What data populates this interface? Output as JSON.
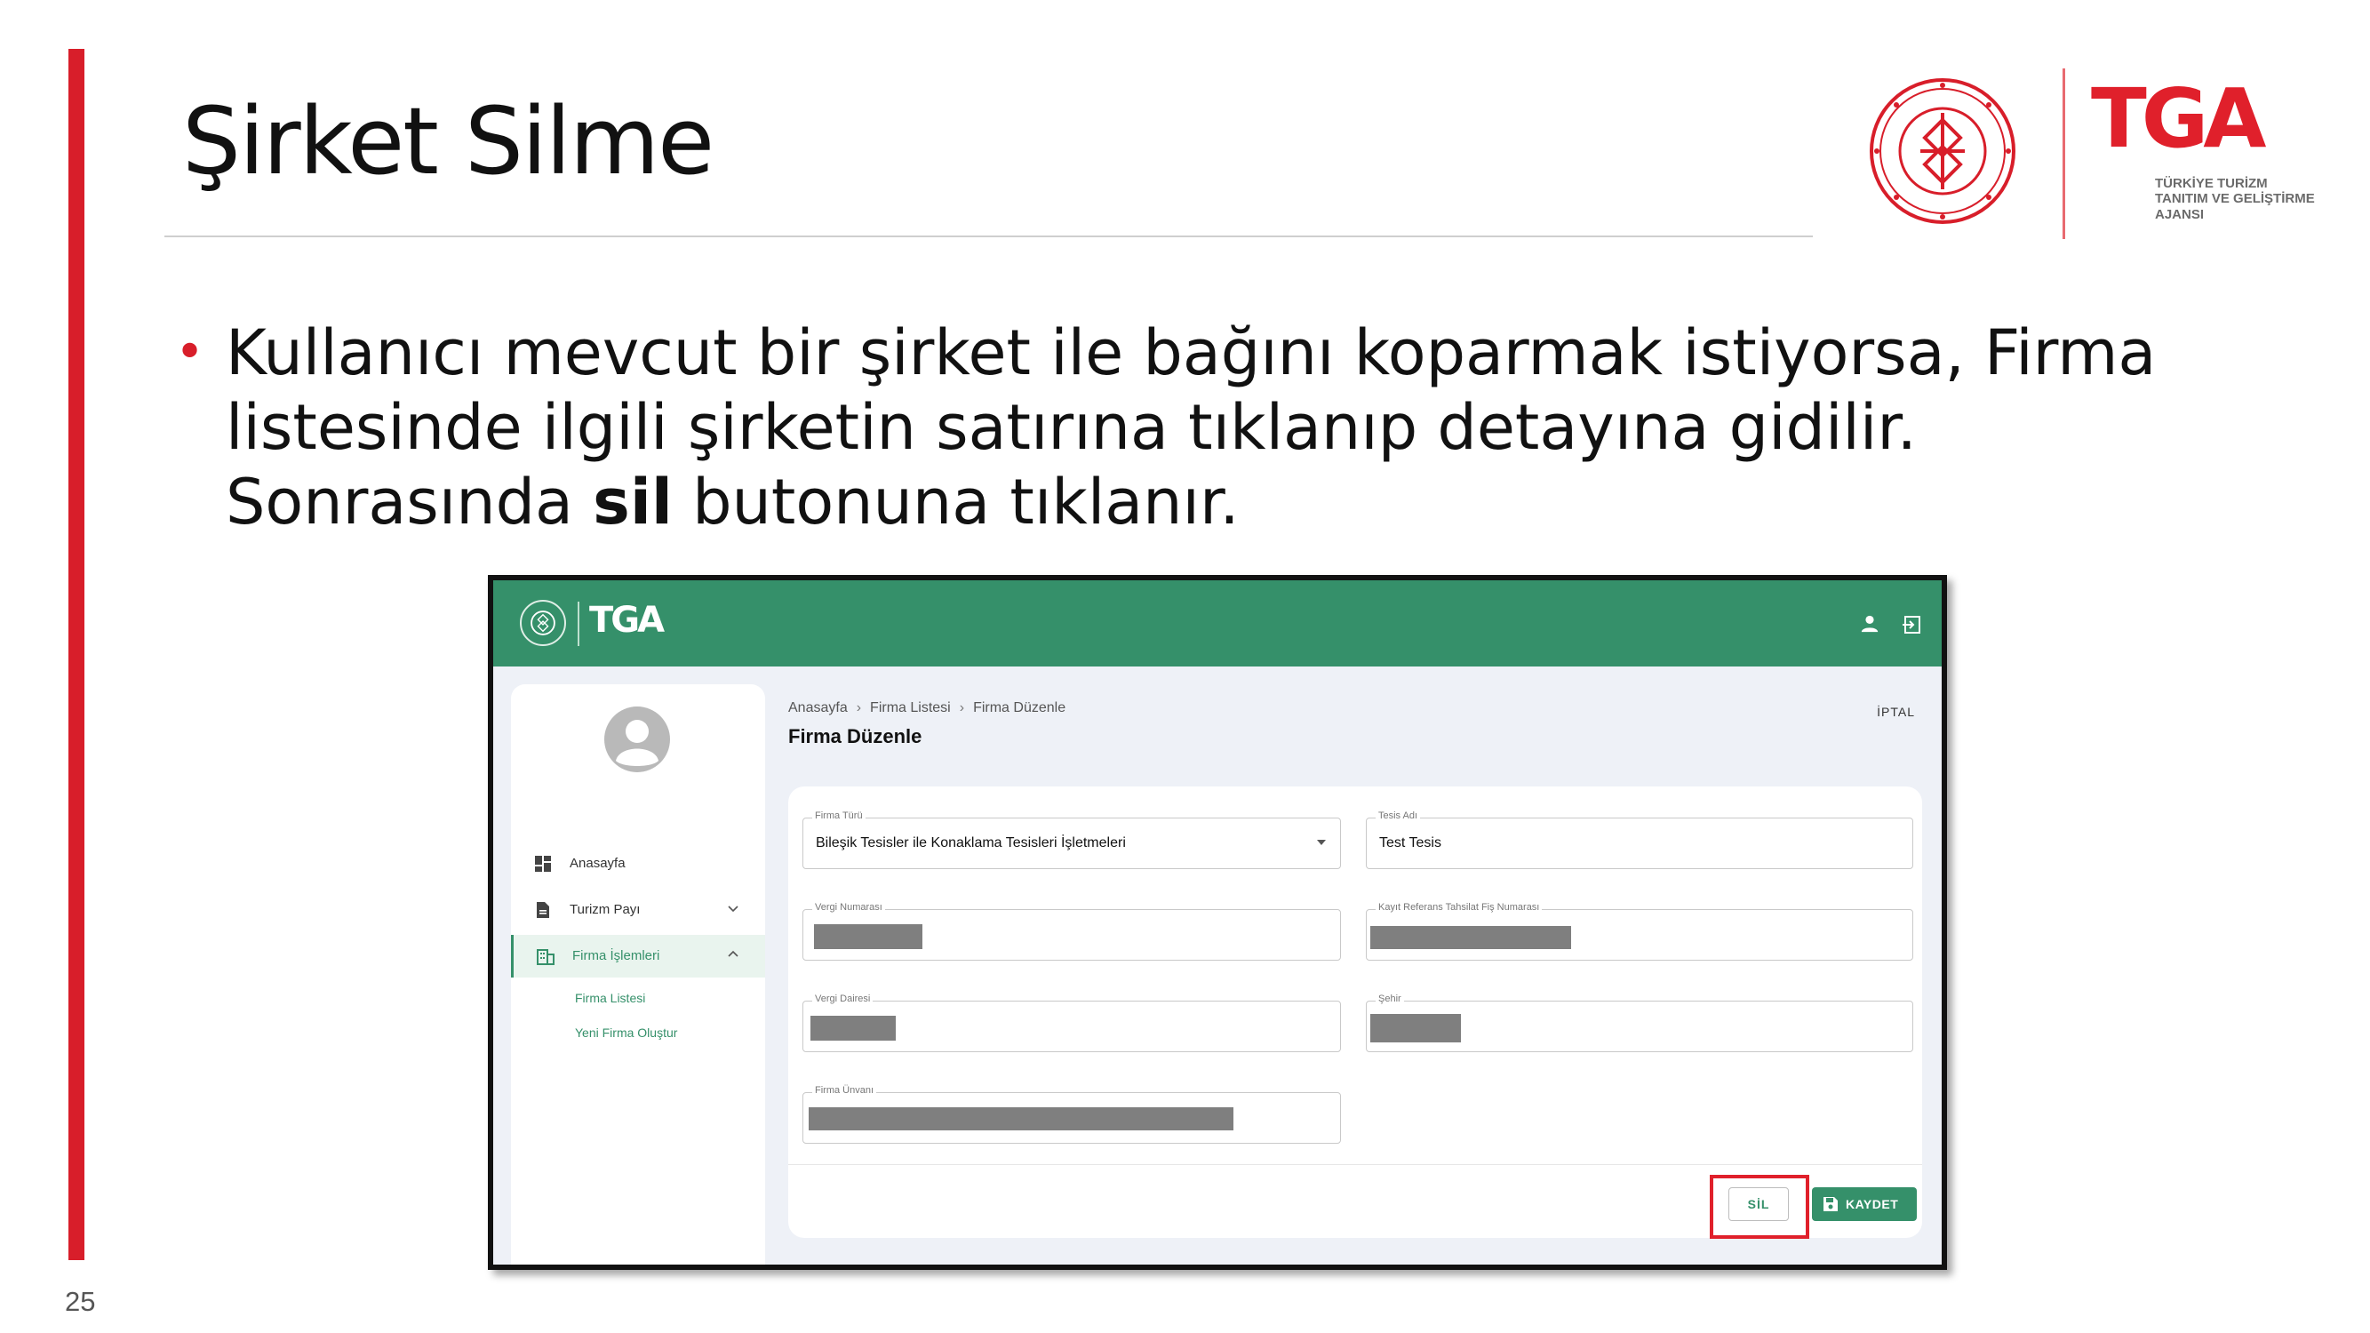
{
  "slide": {
    "title": "Şirket Silme",
    "page_number": "25",
    "bullet_pre": "Kullanıcı mevcut bir şirket ile bağını koparmak istiyorsa, Firma listesinde ilgili şirketin satırına tıklanıp detayına gidilir. Sonrasında ",
    "bullet_bold": "sil",
    "bullet_post": " butonuna tıklanır."
  },
  "logos": {
    "tga_word": "TGA",
    "tga_subtitle_1": "TÜRKİYE TURİZM",
    "tga_subtitle_2": "TANITIM VE GELİŞTİRME",
    "tga_subtitle_3": "AJANSI",
    "seal_icon": "ministry-seal-icon",
    "brand_red": "#e0202b"
  },
  "app": {
    "header_color": "#35906a",
    "header_tga": "TGA",
    "sidebar": {
      "items": [
        {
          "label": "Anasayfa",
          "icon": "dashboard-icon"
        },
        {
          "label": "Turizm Payı",
          "icon": "document-icon"
        },
        {
          "label": "Firma İşlemleri",
          "icon": "building-icon"
        }
      ],
      "sub_items": [
        {
          "label": "Firma Listesi"
        },
        {
          "label": "Yeni Firma Oluştur"
        }
      ]
    },
    "breadcrumb": [
      "Anasayfa",
      "Firma Listesi",
      "Firma Düzenle"
    ],
    "page_title": "Firma Düzenle",
    "cancel_label": "İPTAL",
    "form": {
      "firma_turu": {
        "label": "Firma Türü",
        "value": "Bileşik Tesisler ile Konaklama Tesisleri İşletmeleri"
      },
      "tesis_adi": {
        "label": "Tesis Adı",
        "value": "Test Tesis"
      },
      "vergi_numarasi": {
        "label": "Vergi Numarası"
      },
      "kayit_referans": {
        "label": "Kayıt Referans Tahsilat Fiş Numarası"
      },
      "vergi_dairesi": {
        "label": "Vergi Dairesi"
      },
      "sehir": {
        "label": "Şehir"
      },
      "firma_unvani": {
        "label": "Firma Ünvanı"
      }
    },
    "delete_label": "SİL",
    "save_label": "KAYDET"
  }
}
